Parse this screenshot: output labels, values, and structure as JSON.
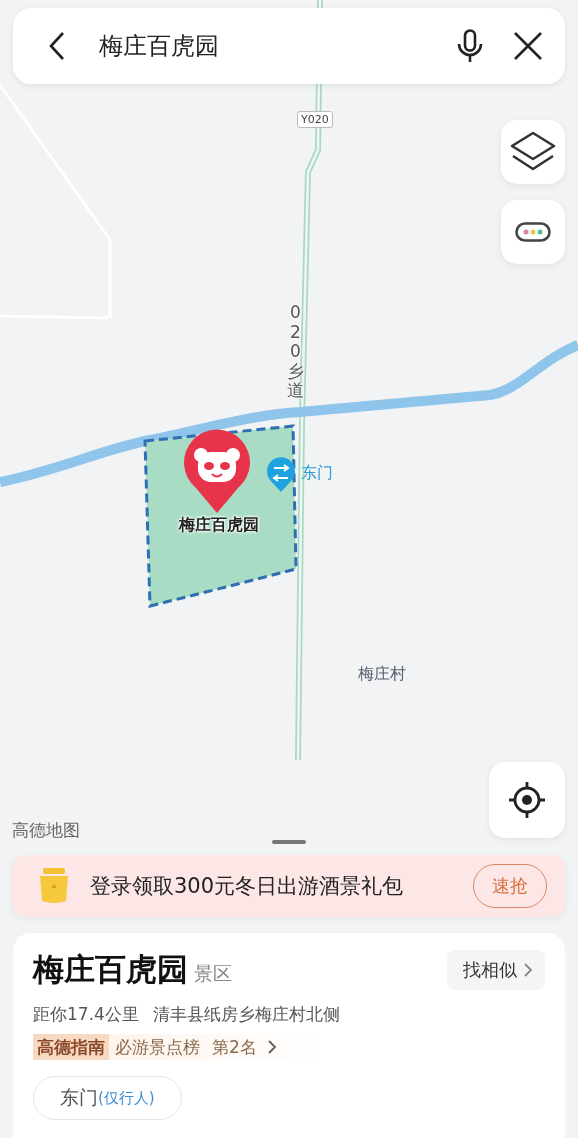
{
  "search": {
    "value": "梅庄百虎园"
  },
  "map": {
    "labels": [
      {
        "kind": "road_badge",
        "text": "Y020"
      },
      {
        "kind": "road_vertical",
        "text": "020乡道"
      },
      {
        "kind": "poi",
        "text": "梅庄百虎园"
      },
      {
        "kind": "gate",
        "text": "东门"
      },
      {
        "kind": "place",
        "text": "梅庄村"
      }
    ],
    "brand": "高德地图"
  },
  "banner": {
    "text": "登录领取300元冬日出游酒景礼包",
    "button": "速抢"
  },
  "place": {
    "name": "梅庄百虎园",
    "category": "景区",
    "similar_button": "找相似",
    "distance": "距你17.4公里",
    "address": "清丰县纸房乡梅庄村北侧",
    "guide_badge": "高德指南",
    "ranking": "必游景点榜",
    "rank": "第2名",
    "entrances": [
      {
        "name": "东门",
        "note": "(仅行人)"
      }
    ]
  }
}
